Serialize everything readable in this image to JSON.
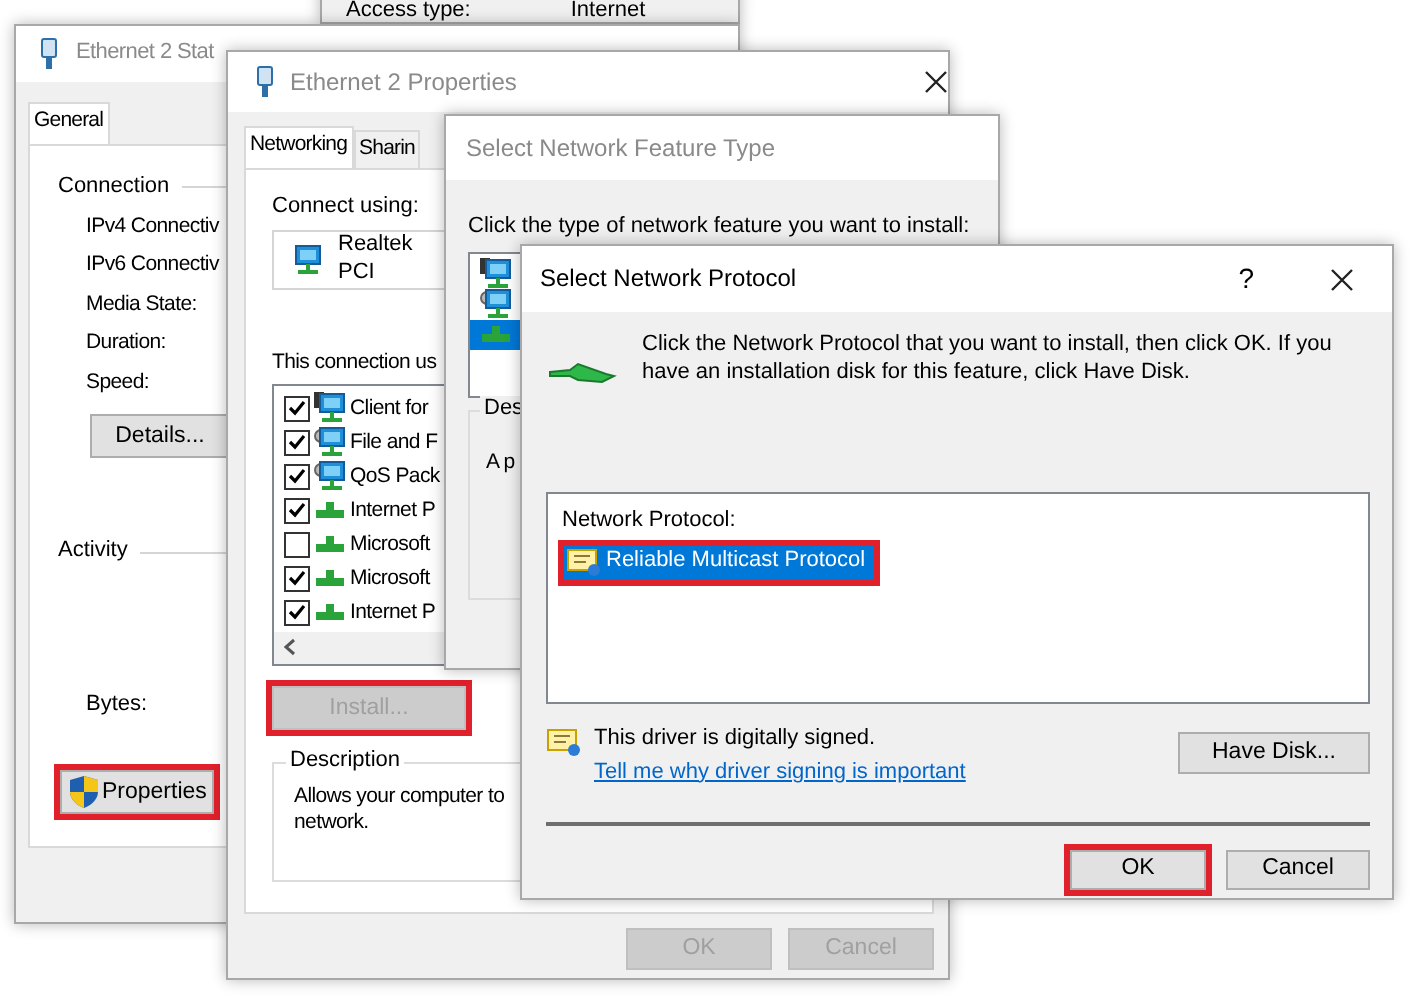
{
  "background_window": {
    "label": "Access type:",
    "value": "Internet"
  },
  "status_window": {
    "title": "Ethernet 2 Stat",
    "tabs": [
      {
        "label": "General",
        "selected": true
      }
    ],
    "connection_heading": "Connection",
    "connection_fields": [
      "IPv4 Connectiv",
      "IPv6 Connectiv",
      "Media State:",
      "Duration:",
      "Speed:"
    ],
    "details_button": "Details...",
    "activity_heading": "Activity",
    "bytes_label": "Bytes:",
    "properties_button": {
      "label": "Properties",
      "highlighted": true
    }
  },
  "properties_window": {
    "title": "Ethernet 2 Properties",
    "tabs": [
      {
        "label": "Networking",
        "selected": true
      },
      {
        "label": "Sharin",
        "selected": false
      }
    ],
    "connect_using_label": "Connect using:",
    "adapter": "Realtek PCI",
    "components_label": "This connection us",
    "components": [
      {
        "label": "Client for",
        "checked": true,
        "kind": "client"
      },
      {
        "label": "File and F",
        "checked": true,
        "kind": "service"
      },
      {
        "label": "QoS Pack",
        "checked": true,
        "kind": "service"
      },
      {
        "label": "Internet P",
        "checked": true,
        "kind": "protocol"
      },
      {
        "label": "Microsoft",
        "checked": false,
        "kind": "protocol"
      },
      {
        "label": "Microsoft",
        "checked": true,
        "kind": "protocol"
      },
      {
        "label": "Internet P",
        "checked": true,
        "kind": "protocol"
      }
    ],
    "install_button": {
      "label": "Install...",
      "disabled": true,
      "highlighted": true
    },
    "description_heading": "Description",
    "description_text": "Allows your computer to\nnetwork.",
    "buttons": [
      {
        "label": "OK",
        "disabled": true
      },
      {
        "label": "Cancel",
        "disabled": true
      }
    ]
  },
  "feature_type_window": {
    "title": "Select Network Feature Type",
    "prompt": "Click the type of network feature you want to install:",
    "types": [
      {
        "kind": "client",
        "selected": false
      },
      {
        "kind": "service",
        "selected": false
      },
      {
        "kind": "protocol",
        "selected": true
      }
    ],
    "description_heading": "Des",
    "description_text": "A p"
  },
  "protocol_window": {
    "title": "Select Network Protocol",
    "help_button": "?",
    "instructions": "Click the Network Protocol that you want to install, then click OK. If you have an installation disk for this feature, click Have Disk.",
    "list_heading": "Network Protocol:",
    "protocols": [
      {
        "label": "Reliable Multicast Protocol",
        "selected": true,
        "highlighted": true
      }
    ],
    "signature_text": "This driver is digitally signed.",
    "signature_link": "Tell me why driver signing is important",
    "have_disk_button": "Have Disk...",
    "buttons": [
      {
        "label": "OK",
        "highlighted": true
      },
      {
        "label": "Cancel",
        "highlighted": false
      }
    ]
  }
}
